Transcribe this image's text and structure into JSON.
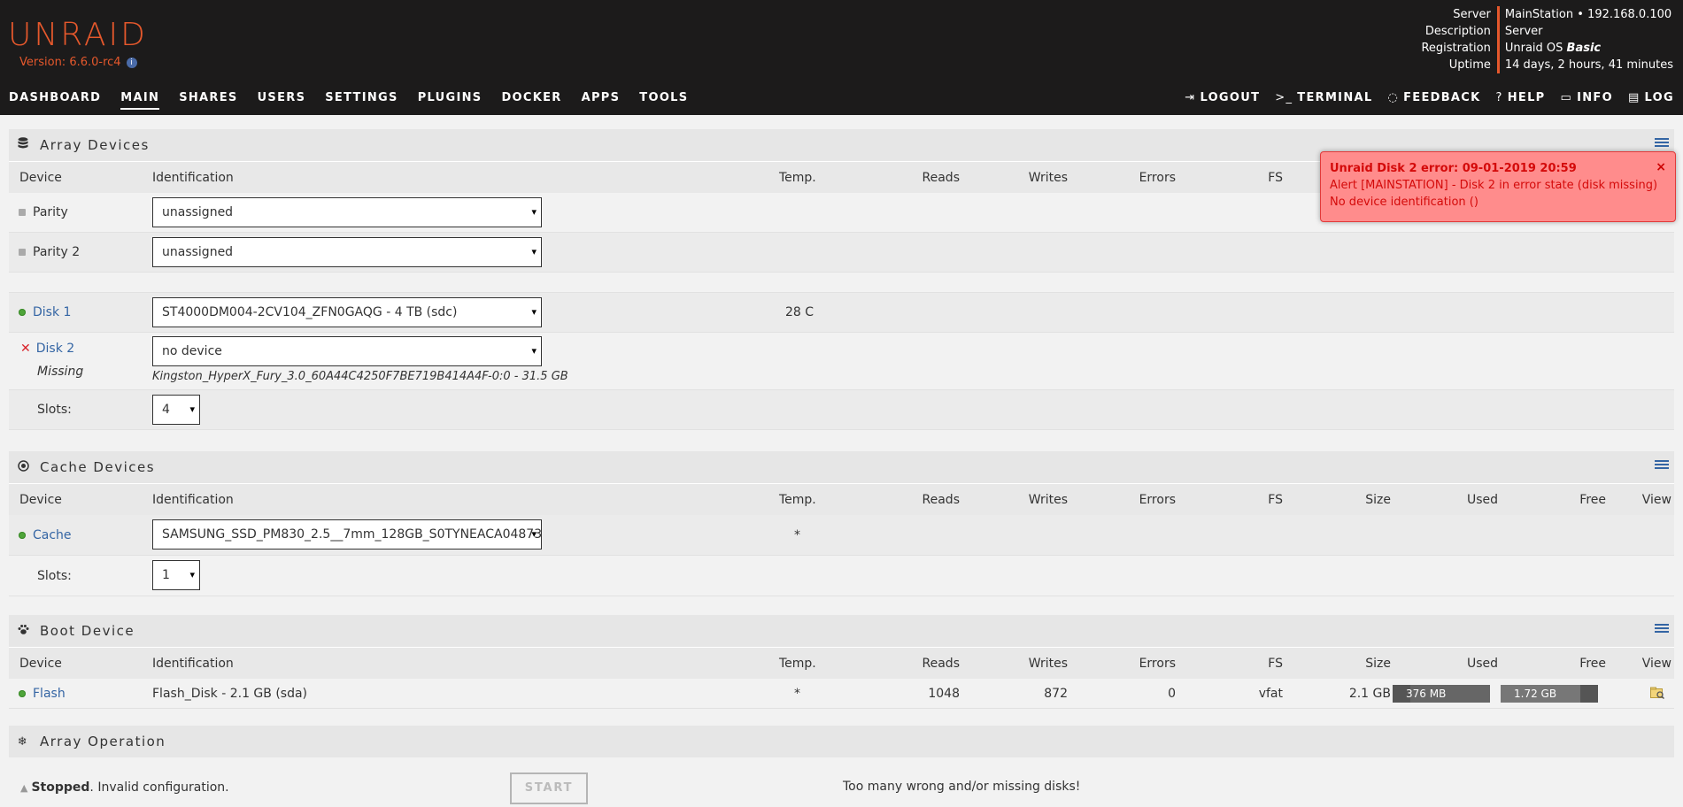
{
  "header": {
    "logo": "UNRAID",
    "version": "Version: 6.6.0-rc4",
    "info_glyph": "i",
    "server_info": {
      "labels": [
        "Server",
        "Description",
        "Registration",
        "Uptime"
      ],
      "server": "MainStation • 192.168.0.100",
      "description": "Server",
      "registration_prefix": "Unraid OS ",
      "registration_edition": "Basic",
      "uptime": "14 days, 2 hours, 41 minutes"
    },
    "nav_left": [
      "DASHBOARD",
      "MAIN",
      "SHARES",
      "USERS",
      "SETTINGS",
      "PLUGINS",
      "DOCKER",
      "APPS",
      "TOOLS"
    ],
    "nav_active": "MAIN",
    "nav_right": [
      {
        "icon": "logout-icon",
        "glyph": "⇥",
        "label": "LOGOUT"
      },
      {
        "icon": "terminal-icon",
        "glyph": ">_",
        "label": "TERMINAL"
      },
      {
        "icon": "feedback-icon",
        "glyph": "◌",
        "label": "FEEDBACK"
      },
      {
        "icon": "help-icon",
        "glyph": "?",
        "label": "HELP"
      },
      {
        "icon": "info-icon",
        "glyph": "▭",
        "label": "INFO"
      },
      {
        "icon": "log-icon",
        "glyph": "▤",
        "label": "LOG"
      }
    ]
  },
  "columns": {
    "device": "Device",
    "identification": "Identification",
    "temp": "Temp.",
    "reads": "Reads",
    "writes": "Writes",
    "errors": "Errors",
    "fs": "FS",
    "size": "Size",
    "used": "Used",
    "free": "Free",
    "view": "View"
  },
  "array": {
    "title": "Array Devices",
    "parity": {
      "name": "Parity",
      "value": "unassigned"
    },
    "parity2": {
      "name": "Parity 2",
      "value": "unassigned"
    },
    "disk1": {
      "name": "Disk 1",
      "value": "ST4000DM004-2CV104_ZFN0GAQG - 4 TB (sdc)",
      "temp": "28 C"
    },
    "disk2": {
      "name": "Disk 2",
      "status": "Missing",
      "value": "no device",
      "missing_id": "Kingston_HyperX_Fury_3.0_60A44C4250F7BE719B414A4F-0:0 - 31.5 GB"
    },
    "slots_label": "Slots:",
    "slots_value": "4"
  },
  "alert": {
    "title": "Unraid Disk 2 error: 09-01-2019 20:59",
    "line1": "Alert [MAINSTATION] - Disk 2 in error state (disk missing)",
    "line2": "No device identification ()",
    "close": "×"
  },
  "cache": {
    "title": "Cache Devices",
    "device": {
      "name": "Cache",
      "value": "SAMSUNG_SSD_PM830_2.5__7mm_128GB_S0TYNEACA04873 -",
      "temp": "*"
    },
    "slots_label": "Slots:",
    "slots_value": "1"
  },
  "boot": {
    "title": "Boot Device",
    "flash": {
      "name": "Flash",
      "id": "Flash_Disk - 2.1 GB (sda)",
      "temp": "*",
      "reads": "1048",
      "writes": "872",
      "errors": "0",
      "fs": "vfat",
      "size": "2.1 GB",
      "used": "376 MB",
      "free": "1.72 GB",
      "used_fraction": 0.18,
      "free_fraction": 0.82
    }
  },
  "operation": {
    "title": "Array Operation",
    "status_bold": "Stopped",
    "status_rest": ". Invalid configuration.",
    "start_label": "START",
    "message": "Too many wrong and/or missing disks!"
  }
}
